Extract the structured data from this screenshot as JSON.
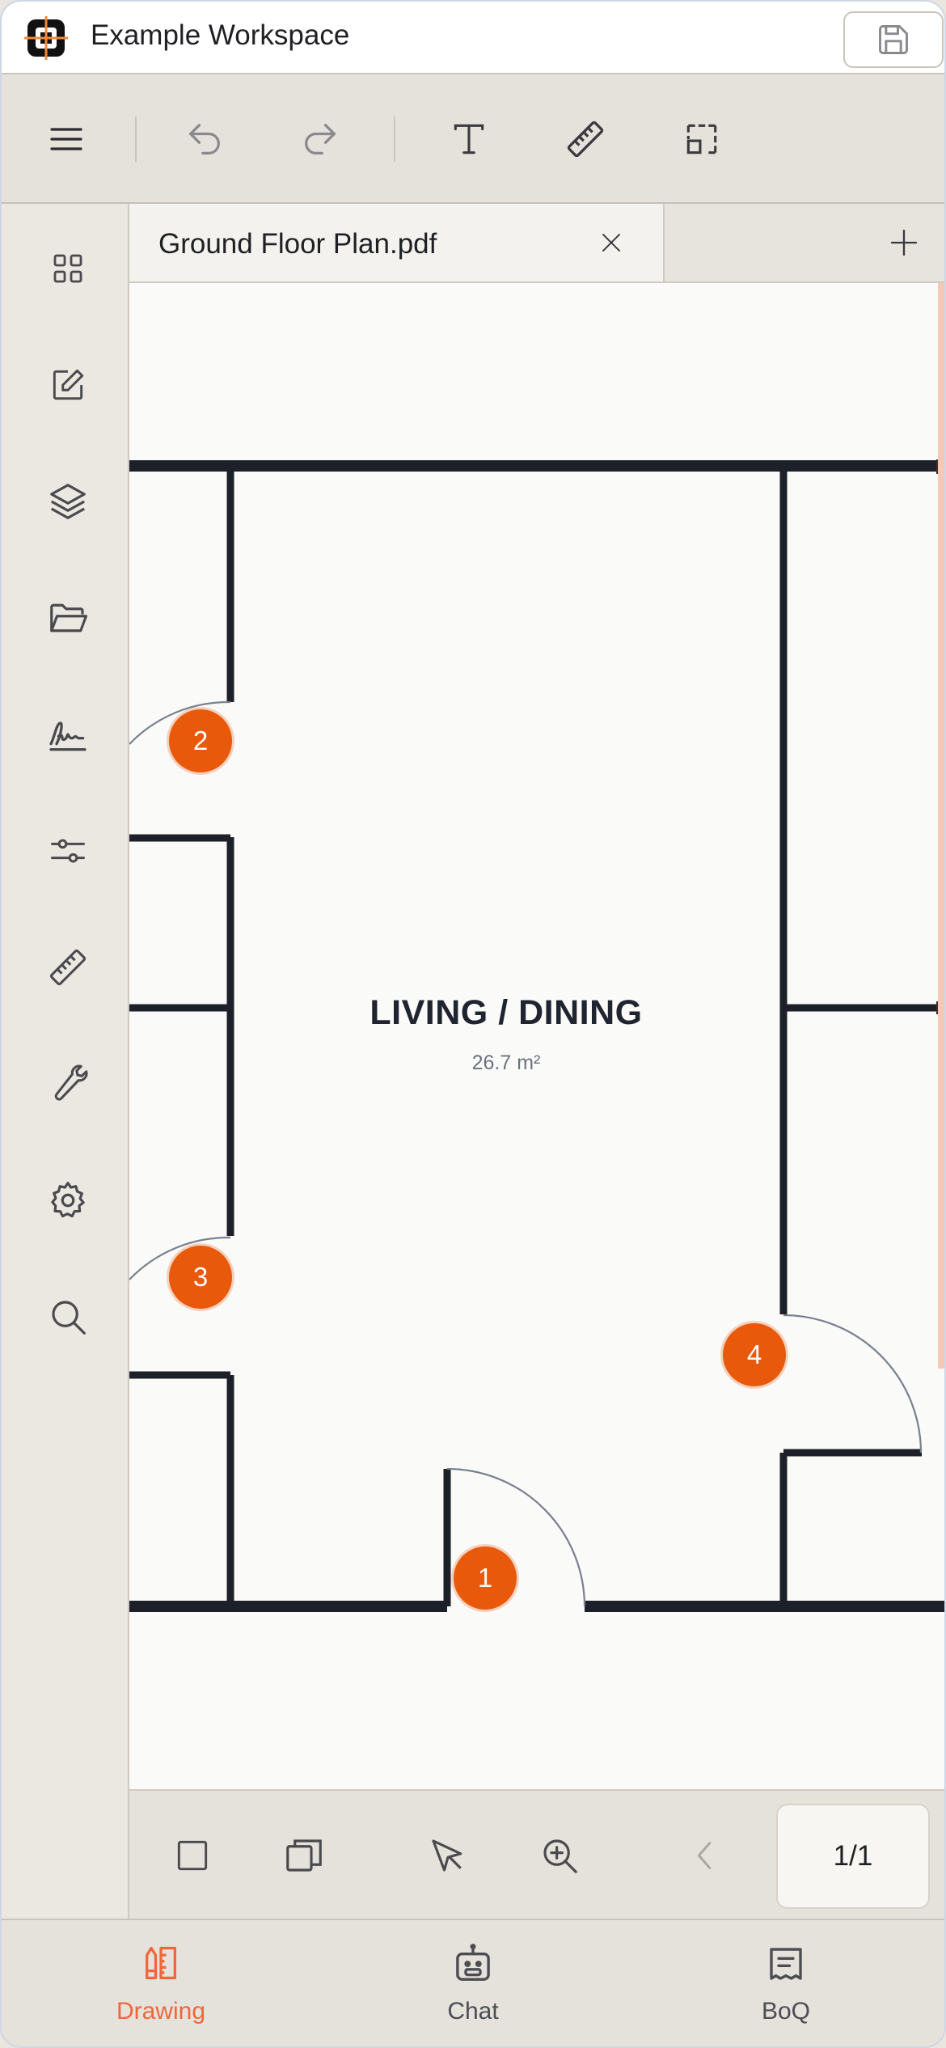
{
  "app": {
    "workspace_name": "Example Workspace",
    "save_icon": "floppy-disk-icon"
  },
  "toolbar": {
    "items": [
      "menu-icon",
      "undo-icon",
      "redo-icon",
      "text-tool-icon",
      "ruler-icon",
      "select-area-icon"
    ]
  },
  "sidebar": {
    "items": [
      "grid-icon",
      "edit-icon",
      "layers-icon",
      "folder-icon",
      "signature-icon",
      "sliders-icon",
      "ruler-icon",
      "wrench-icon",
      "settings-icon",
      "search-icon"
    ]
  },
  "tabs": [
    {
      "label": "Ground Floor Plan.pdf",
      "active": true
    }
  ],
  "canvas": {
    "room_name": "LIVING / DINING",
    "room_area": "26.7 m²",
    "markers": [
      {
        "label": "1"
      },
      {
        "label": "2"
      },
      {
        "label": "3"
      },
      {
        "label": "4"
      }
    ],
    "accent_color": "#e8590c"
  },
  "canvas_tools": {
    "items": [
      "rectangle-icon",
      "stacked-pages-icon",
      "pointer-icon",
      "zoom-in-icon",
      "chevron-left-icon"
    ],
    "page_indicator": "1/1"
  },
  "bottom_nav": {
    "items": [
      {
        "label": "Drawing",
        "icon": "drawing-tools-icon",
        "active": true
      },
      {
        "label": "Chat",
        "icon": "robot-icon",
        "active": false
      },
      {
        "label": "BoQ",
        "icon": "receipt-icon",
        "active": false
      }
    ],
    "active_color": "#f0663a"
  }
}
